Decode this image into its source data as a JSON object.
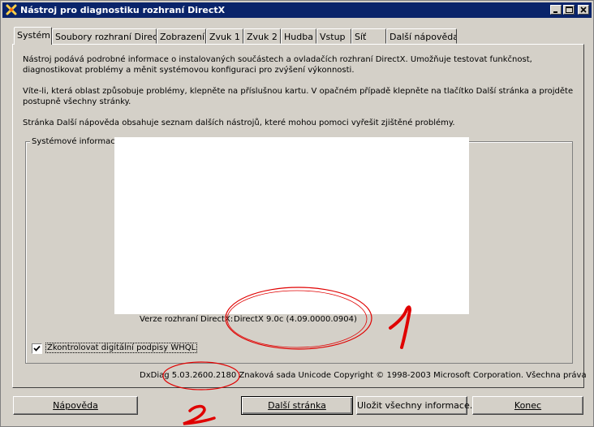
{
  "window": {
    "title": "Nástroj pro diagnostiku rozhraní DirectX",
    "minimize": "minimize",
    "maximize": "maximize",
    "close": "close"
  },
  "tabs": [
    {
      "label": "Systém",
      "active": true
    },
    {
      "label": "Soubory rozhraní DirectX"
    },
    {
      "label": "Zobrazení"
    },
    {
      "label": "Zvuk 1"
    },
    {
      "label": "Zvuk 2"
    },
    {
      "label": "Hudba"
    },
    {
      "label": "Vstup"
    },
    {
      "label": "Síť"
    },
    {
      "label": "Další nápověda"
    }
  ],
  "intro": {
    "p1": "Nástroj podává podrobné informace o instalovaných součástech a ovladačích rozhraní DirectX. Umožňuje testovat funkčnost, diagnostikovat problémy a měnit systémovou konfiguraci pro zvýšení výkonnosti.",
    "p2": "Víte-li, která oblast způsobuje problémy, klepněte na příslušnou kartu. V opačném případě klepněte na tlačítko Další stránka a projděte postupně všechny stránky.",
    "p3": "Stránka Další nápověda obsahuje seznam dalších nástrojů, které mohou pomoci vyřešit zjištěné problémy."
  },
  "system_info": {
    "group_label": "Systémové informace",
    "directx_version_label": "Verze rozhraní DirectX:",
    "directx_version_value": "DirectX 9.0c (4.09.0000.0904)"
  },
  "whql_checkbox": {
    "label": "Zkontrolovat digitální podpisy WHQL",
    "checked": true
  },
  "status_line": "DxDiag 5.03.2600.2180 Znaková sada Unicode  Copyright © 1998-2003 Microsoft Corporation. Všechna práva",
  "buttons": {
    "help": "Nápověda",
    "next_page": "Další stránka",
    "save_all": "Uložit všechny informace...",
    "exit": "Konec"
  },
  "annotations": {
    "mark1": "1",
    "mark2": "2",
    "color": "#e00000"
  },
  "colors": {
    "titlebar": "#0a246a",
    "face": "#d4d0c8"
  }
}
